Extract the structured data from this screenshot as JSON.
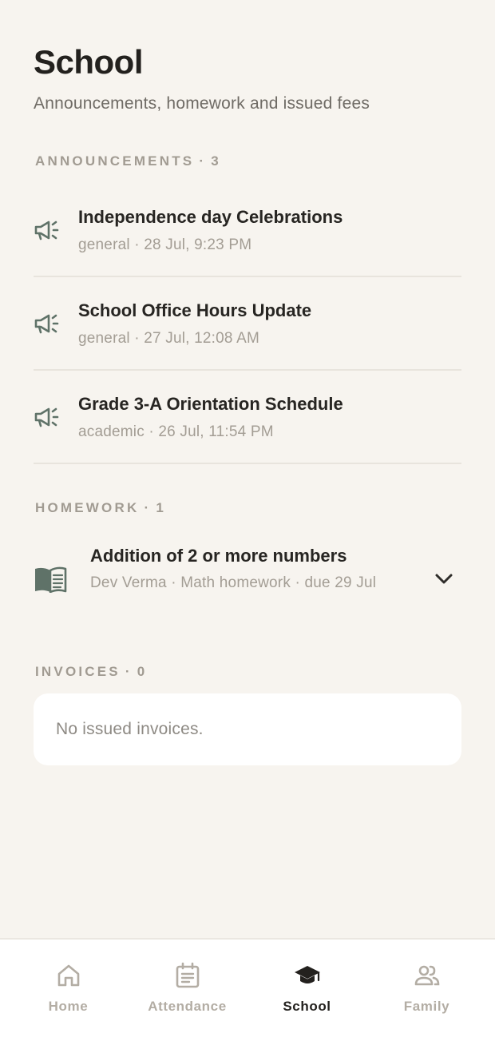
{
  "page": {
    "title": "School",
    "subtitle": "Announcements, homework and issued fees"
  },
  "announcements": {
    "label": "ANNOUNCEMENTS",
    "count": "3",
    "items": [
      {
        "title": "Independence day Celebrations",
        "meta": "general · 28 Jul, 9:23 PM",
        "icon": "megaphone-icon"
      },
      {
        "title": "School Office Hours Update",
        "meta": "general · 27 Jul, 12:08 AM",
        "icon": "megaphone-icon"
      },
      {
        "title": "Grade 3-A Orientation Schedule",
        "meta": "academic · 26 Jul, 11:54 PM",
        "icon": "megaphone-icon"
      }
    ]
  },
  "homework": {
    "label": "HOMEWORK",
    "count": "1",
    "items": [
      {
        "title": "Addition of 2 or more numbers",
        "meta": "Dev Verma · Math homework · due 29 Jul",
        "icon": "book-icon",
        "expand_icon": "chevron-down-icon"
      }
    ]
  },
  "invoices": {
    "label": "INVOICES",
    "count": "0",
    "empty_text": "No issued invoices."
  },
  "nav": {
    "active": "School",
    "items": [
      {
        "label": "Home",
        "icon": "home-icon"
      },
      {
        "label": "Attendance",
        "icon": "calendar-icon"
      },
      {
        "label": "School",
        "icon": "graduation-cap-icon"
      },
      {
        "label": "Family",
        "icon": "people-icon"
      }
    ]
  },
  "colors": {
    "background": "#f7f4ef",
    "card": "#ffffff",
    "icon_green": "#5f7268",
    "muted": "#a39d94",
    "nav_inactive": "#b3ada4"
  }
}
